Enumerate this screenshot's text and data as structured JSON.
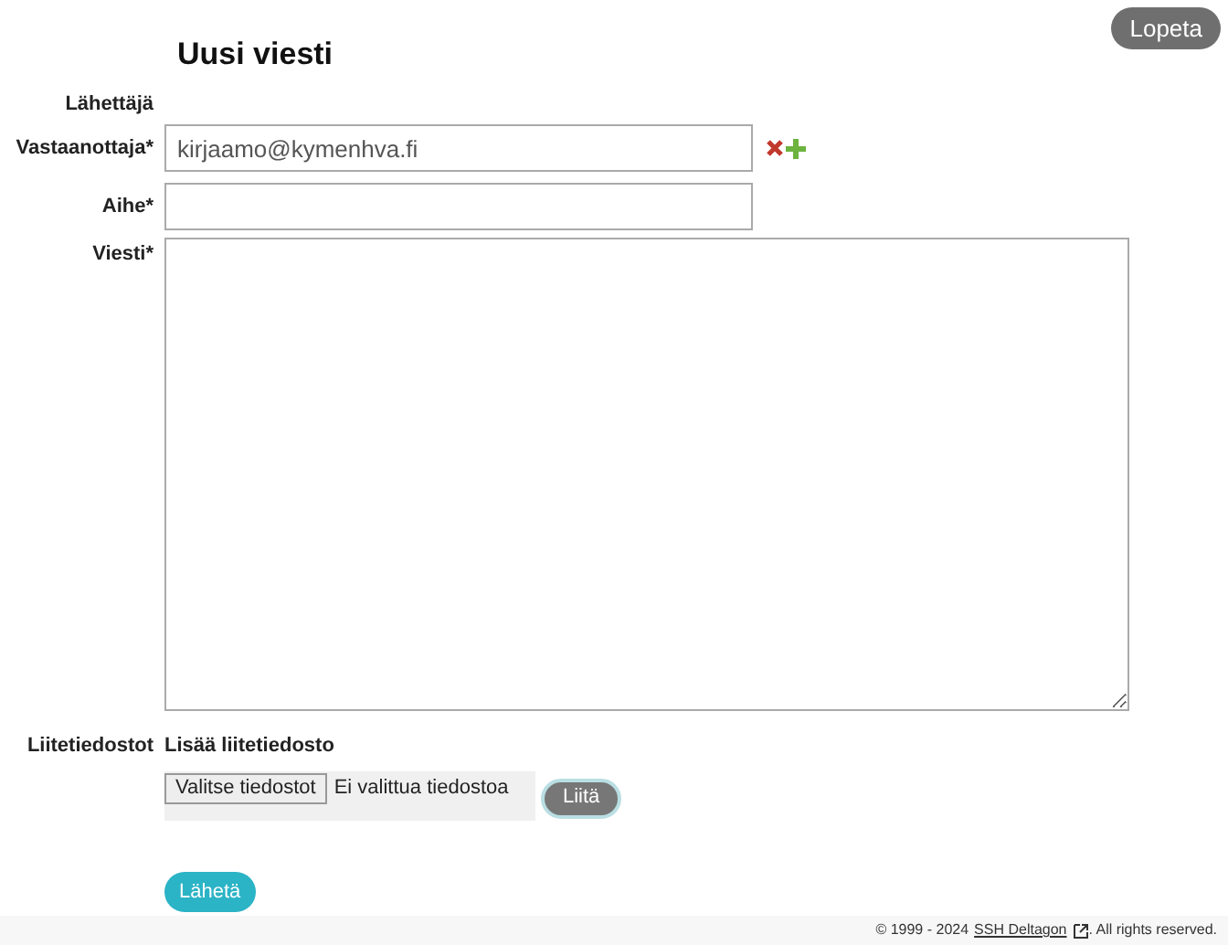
{
  "header": {
    "title": "Uusi viesti",
    "logout_button": "Lopeta"
  },
  "form": {
    "sender_label": "Lähettäjä",
    "recipient": {
      "label": "Vastaanottaja*",
      "value": "kirjaamo@kymenhva.fi"
    },
    "subject": {
      "label": "Aihe*"
    },
    "message": {
      "label": "Viesti*"
    },
    "attachments": {
      "label": "Liitetiedostot",
      "heading": "Lisää liitetiedosto",
      "choose_button": "Valitse tiedostot",
      "file_status": "Ei valittua tiedostoa",
      "attach_button": "Liitä"
    },
    "send_button": "Lähetä"
  },
  "footer": {
    "prefix": "© 1999 - 2024",
    "link": "SSH Deltagon",
    "suffix": ". All rights reserved."
  }
}
